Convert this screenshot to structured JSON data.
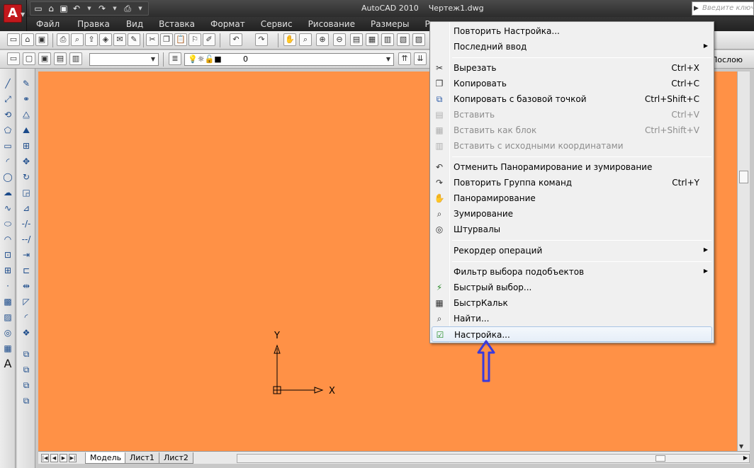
{
  "title_bar": {
    "app_title": "AutoCAD 2010",
    "document": "Чертеж1.dwg",
    "search_placeholder": "Введите ключевое слово",
    "app_logo": "A"
  },
  "quick_access": [
    {
      "name": "new-icon",
      "glyph": "▭"
    },
    {
      "name": "open-icon",
      "glyph": "⌂"
    },
    {
      "name": "save-icon",
      "glyph": "▣"
    },
    {
      "name": "undo-icon",
      "glyph": "↶"
    },
    {
      "name": "redo-icon",
      "glyph": "↷"
    },
    {
      "name": "print-icon",
      "glyph": "⎙"
    }
  ],
  "menubar": [
    "Файл",
    "Правка",
    "Вид",
    "Вставка",
    "Формат",
    "Сервис",
    "Рисование",
    "Размеры",
    "Редакти"
  ],
  "layer_toolbar": {
    "current_layer": "0",
    "by_layer_label": "Послою"
  },
  "context_menu": {
    "items": [
      {
        "label": "Повторить Настройка...",
        "shortcut": "",
        "icon": "",
        "submenu": false,
        "disabled": false,
        "highlighted": false
      },
      {
        "label": "Последний ввод",
        "shortcut": "",
        "icon": "",
        "submenu": true,
        "disabled": false,
        "highlighted": false
      },
      {
        "label": "Вырезать",
        "shortcut": "Ctrl+X",
        "icon": "scissors-icon",
        "submenu": false,
        "disabled": false,
        "highlighted": false
      },
      {
        "label": "Копировать",
        "shortcut": "Ctrl+C",
        "icon": "copy-icon",
        "submenu": false,
        "disabled": false,
        "highlighted": false
      },
      {
        "label": "Копировать с базовой точкой",
        "shortcut": "Ctrl+Shift+C",
        "icon": "copy-base-icon",
        "submenu": false,
        "disabled": false,
        "highlighted": false
      },
      {
        "label": "Вставить",
        "shortcut": "Ctrl+V",
        "icon": "paste-icon",
        "submenu": false,
        "disabled": true,
        "highlighted": false
      },
      {
        "label": "Вставить как блок",
        "shortcut": "Ctrl+Shift+V",
        "icon": "paste-block-icon",
        "submenu": false,
        "disabled": true,
        "highlighted": false
      },
      {
        "label": "Вставить с исходными координатами",
        "shortcut": "",
        "icon": "paste-coords-icon",
        "submenu": false,
        "disabled": true,
        "highlighted": false
      },
      {
        "label": "Отменить Панорамирование и зумирование",
        "shortcut": "",
        "icon": "undo-icon",
        "submenu": false,
        "disabled": false,
        "highlighted": false
      },
      {
        "label": "Повторить Группа команд",
        "shortcut": "Ctrl+Y",
        "icon": "redo-icon",
        "submenu": false,
        "disabled": false,
        "highlighted": false
      },
      {
        "label": "Панорамирование",
        "shortcut": "",
        "icon": "pan-icon",
        "submenu": false,
        "disabled": false,
        "highlighted": false
      },
      {
        "label": "Зумирование",
        "shortcut": "",
        "icon": "zoom-icon",
        "submenu": false,
        "disabled": false,
        "highlighted": false
      },
      {
        "label": "Штурвалы",
        "shortcut": "",
        "icon": "steering-wheel-icon",
        "submenu": false,
        "disabled": false,
        "highlighted": false
      },
      {
        "label": "Рекордер операций",
        "shortcut": "",
        "icon": "",
        "submenu": true,
        "disabled": false,
        "highlighted": false
      },
      {
        "label": "Фильтр выбора подобъектов",
        "shortcut": "",
        "icon": "",
        "submenu": true,
        "disabled": false,
        "highlighted": false
      },
      {
        "label": "Быстрый выбор...",
        "shortcut": "",
        "icon": "quick-select-icon",
        "submenu": false,
        "disabled": false,
        "highlighted": false
      },
      {
        "label": "БыстрКальк",
        "shortcut": "",
        "icon": "calculator-icon",
        "submenu": false,
        "disabled": false,
        "highlighted": false
      },
      {
        "label": "Найти...",
        "shortcut": "",
        "icon": "find-icon",
        "submenu": false,
        "disabled": false,
        "highlighted": false
      },
      {
        "label": "Настройка...",
        "shortcut": "",
        "icon": "options-check-icon",
        "submenu": false,
        "disabled": false,
        "highlighted": true
      }
    ]
  },
  "ucs": {
    "x_label": "X",
    "y_label": "Y"
  },
  "layout_tabs": [
    "Модель",
    "Лист1",
    "Лист2"
  ],
  "colors": {
    "drawing_background": "#ff9146",
    "annotation_arrow": "#3a3adc",
    "title_bar": "#2c2c2c"
  }
}
